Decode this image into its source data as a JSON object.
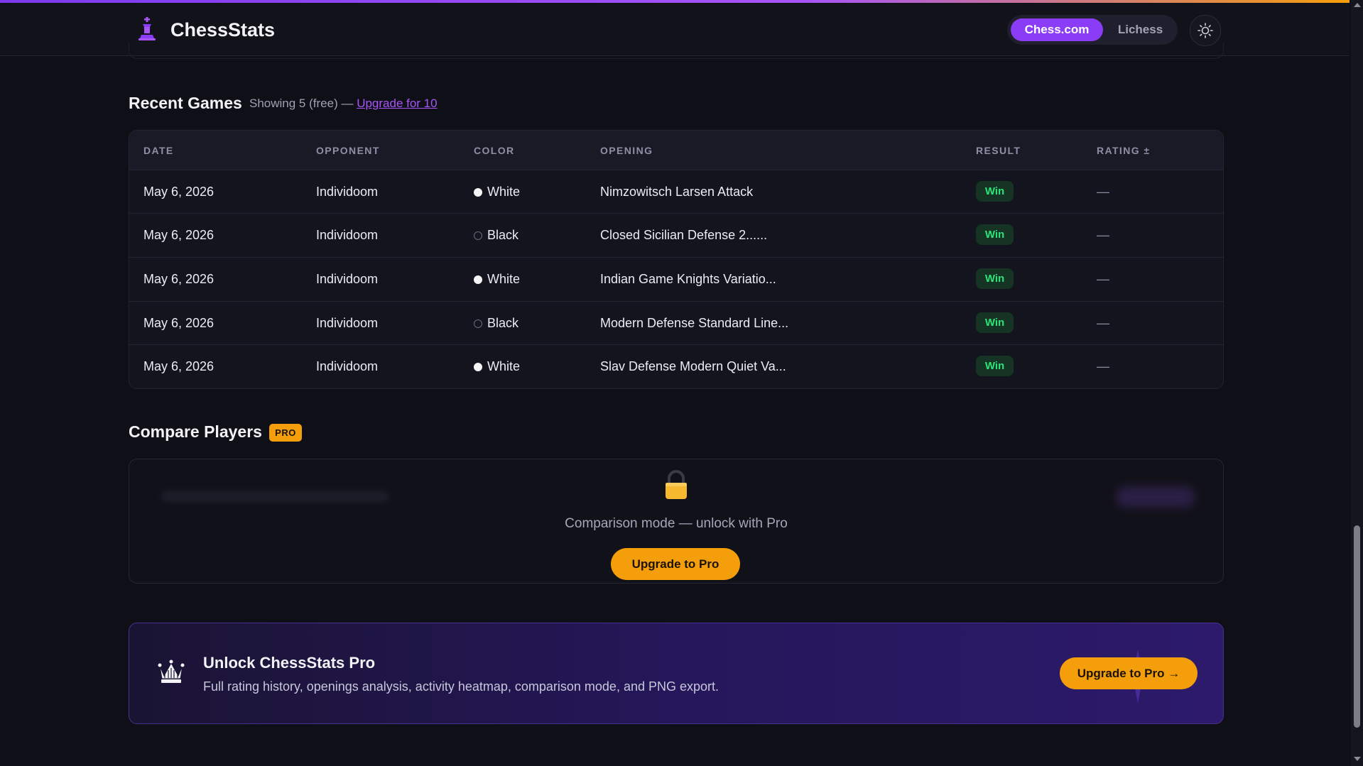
{
  "header": {
    "brand": "ChessStats",
    "logo_icon": "chess-piece-icon",
    "segments": [
      "Chess.com",
      "Lichess"
    ],
    "active_segment": "Chess.com",
    "theme_icon": "sun-icon"
  },
  "recent_games": {
    "title": "Recent Games",
    "subtitle_prefix": "Showing 5 (free) —",
    "upgrade_link": "Upgrade for 10",
    "columns": [
      "DATE",
      "OPPONENT",
      "COLOR",
      "OPENING",
      "RESULT",
      "RATING ±"
    ],
    "rows": [
      {
        "date": "May 6, 2026",
        "opponent": "Individoom",
        "color": "White",
        "opening": "Nimzowitsch Larsen Attack",
        "result": "Win",
        "rating": "—"
      },
      {
        "date": "May 6, 2026",
        "opponent": "Individoom",
        "color": "Black",
        "opening": "Closed Sicilian Defense 2......",
        "result": "Win",
        "rating": "—"
      },
      {
        "date": "May 6, 2026",
        "opponent": "Individoom",
        "color": "White",
        "opening": "Indian Game Knights Variatio...",
        "result": "Win",
        "rating": "—"
      },
      {
        "date": "May 6, 2026",
        "opponent": "Individoom",
        "color": "Black",
        "opening": "Modern Defense Standard Line...",
        "result": "Win",
        "rating": "—"
      },
      {
        "date": "May 6, 2026",
        "opponent": "Individoom",
        "color": "White",
        "opening": "Slav Defense Modern Quiet Va...",
        "result": "Win",
        "rating": "—"
      }
    ]
  },
  "compare": {
    "title": "Compare Players",
    "badge": "PRO",
    "lock_icon": "lock-icon",
    "message": "Comparison mode — unlock with Pro",
    "button": "Upgrade to Pro"
  },
  "promo": {
    "icon": "crown-icon",
    "title": "Unlock ChessStats Pro",
    "description": "Full rating history, openings analysis, activity heatmap, comparison mode, and PNG export.",
    "button": "Upgrade to Pro →"
  },
  "colors": {
    "accent_purple": "#8b3cf6",
    "accent_amber": "#f59e0b",
    "win_green": "#2ee37a"
  }
}
